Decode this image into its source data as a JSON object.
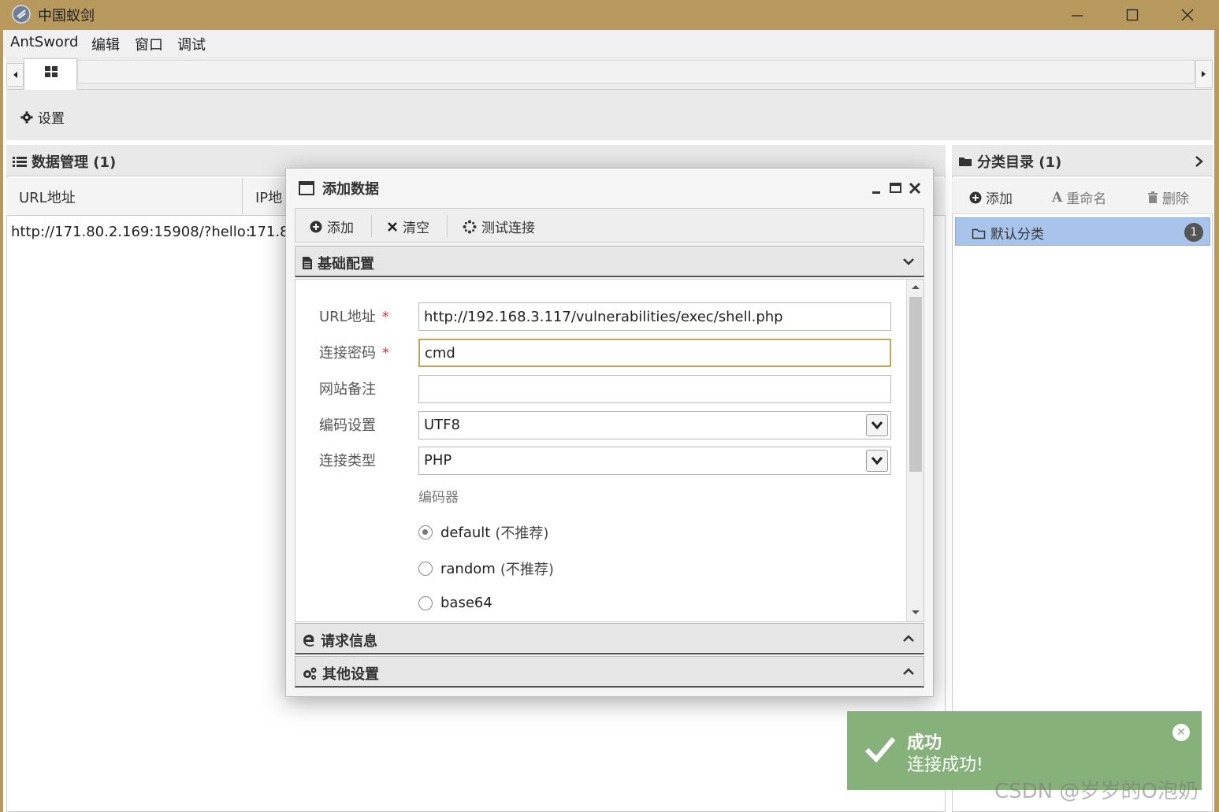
{
  "window": {
    "title": "中国蚁剑",
    "colors": {
      "titlebar": "#b8995d",
      "accent": "#c7a45c",
      "selection": "#a9c4ea",
      "toast": "#86b17a"
    }
  },
  "menu": {
    "items": [
      "AntSword",
      "编辑",
      "窗口",
      "调试"
    ]
  },
  "toolbar": {
    "settings_label": "设置"
  },
  "data_panel": {
    "title": "数据管理 (1)",
    "columns": [
      "URL地址",
      "IP地"
    ],
    "rows": [
      {
        "url": "http://171.80.2.169:15908/?hello:",
        "ip": "171.8"
      }
    ]
  },
  "category_panel": {
    "title": "分类目录 (1)",
    "buttons": {
      "add": "添加",
      "rename": "重命名",
      "delete": "删除"
    },
    "items": [
      {
        "label": "默认分类",
        "count": "1"
      }
    ]
  },
  "dialog": {
    "title": "添加数据",
    "toolbar": {
      "add": "添加",
      "clear": "清空",
      "test": "测试连接"
    },
    "sections": {
      "basic": "基础配置",
      "request": "请求信息",
      "other": "其他设置"
    },
    "form": {
      "url_label": "URL地址",
      "url_value": "http://192.168.3.117/vulnerabilities/exec/shell.php",
      "password_label": "连接密码",
      "password_value": "cmd",
      "note_label": "网站备注",
      "note_value": "",
      "encoding_label": "编码设置",
      "encoding_value": "UTF8",
      "type_label": "连接类型",
      "type_value": "PHP",
      "encoder_label": "编码器",
      "encoders": [
        {
          "name": "default",
          "hint": "(不推荐)",
          "selected": true
        },
        {
          "name": "random",
          "hint": "(不推荐)",
          "selected": false
        },
        {
          "name": "base64",
          "hint": "",
          "selected": false
        }
      ]
    }
  },
  "toast": {
    "title": "成功",
    "message": "连接成功!"
  },
  "watermark": "CSDN @岁岁的O泡奶"
}
